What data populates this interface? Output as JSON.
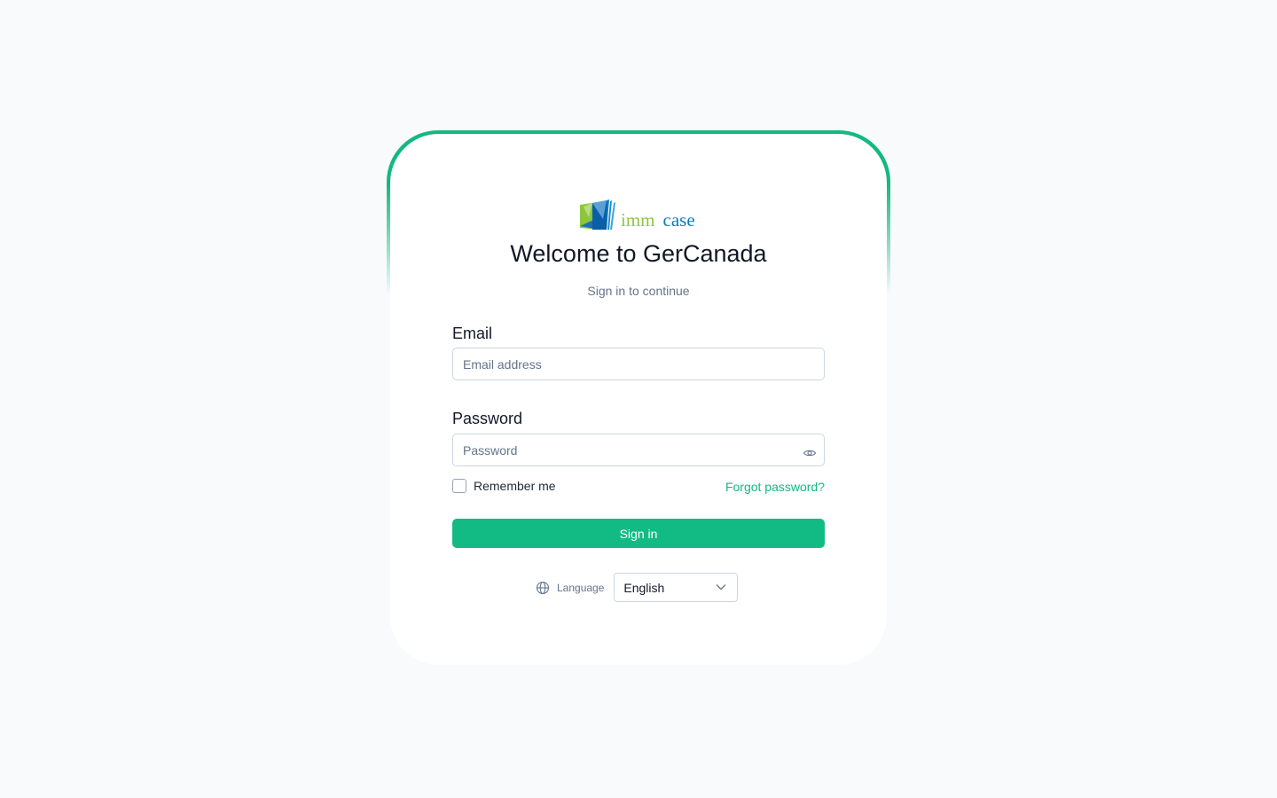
{
  "brand": {
    "logo_word_1": "imm",
    "logo_word_2": "case",
    "green": "#8cc63f",
    "blue": "#0a7bc2"
  },
  "header": {
    "title": "Welcome to GerCanada",
    "subtitle": "Sign in to continue"
  },
  "form": {
    "email_label": "Email",
    "email_placeholder": "Email address",
    "email_value": "",
    "password_label": "Password",
    "password_placeholder": "Password",
    "password_value": "",
    "remember_label": "Remember me",
    "forgot_label": "Forgot password?",
    "submit_label": "Sign in"
  },
  "language": {
    "label": "Language",
    "selected": "English",
    "icon": "globe-icon"
  },
  "colors": {
    "accent": "#13bb84",
    "page_bg": "#f8fafc"
  }
}
